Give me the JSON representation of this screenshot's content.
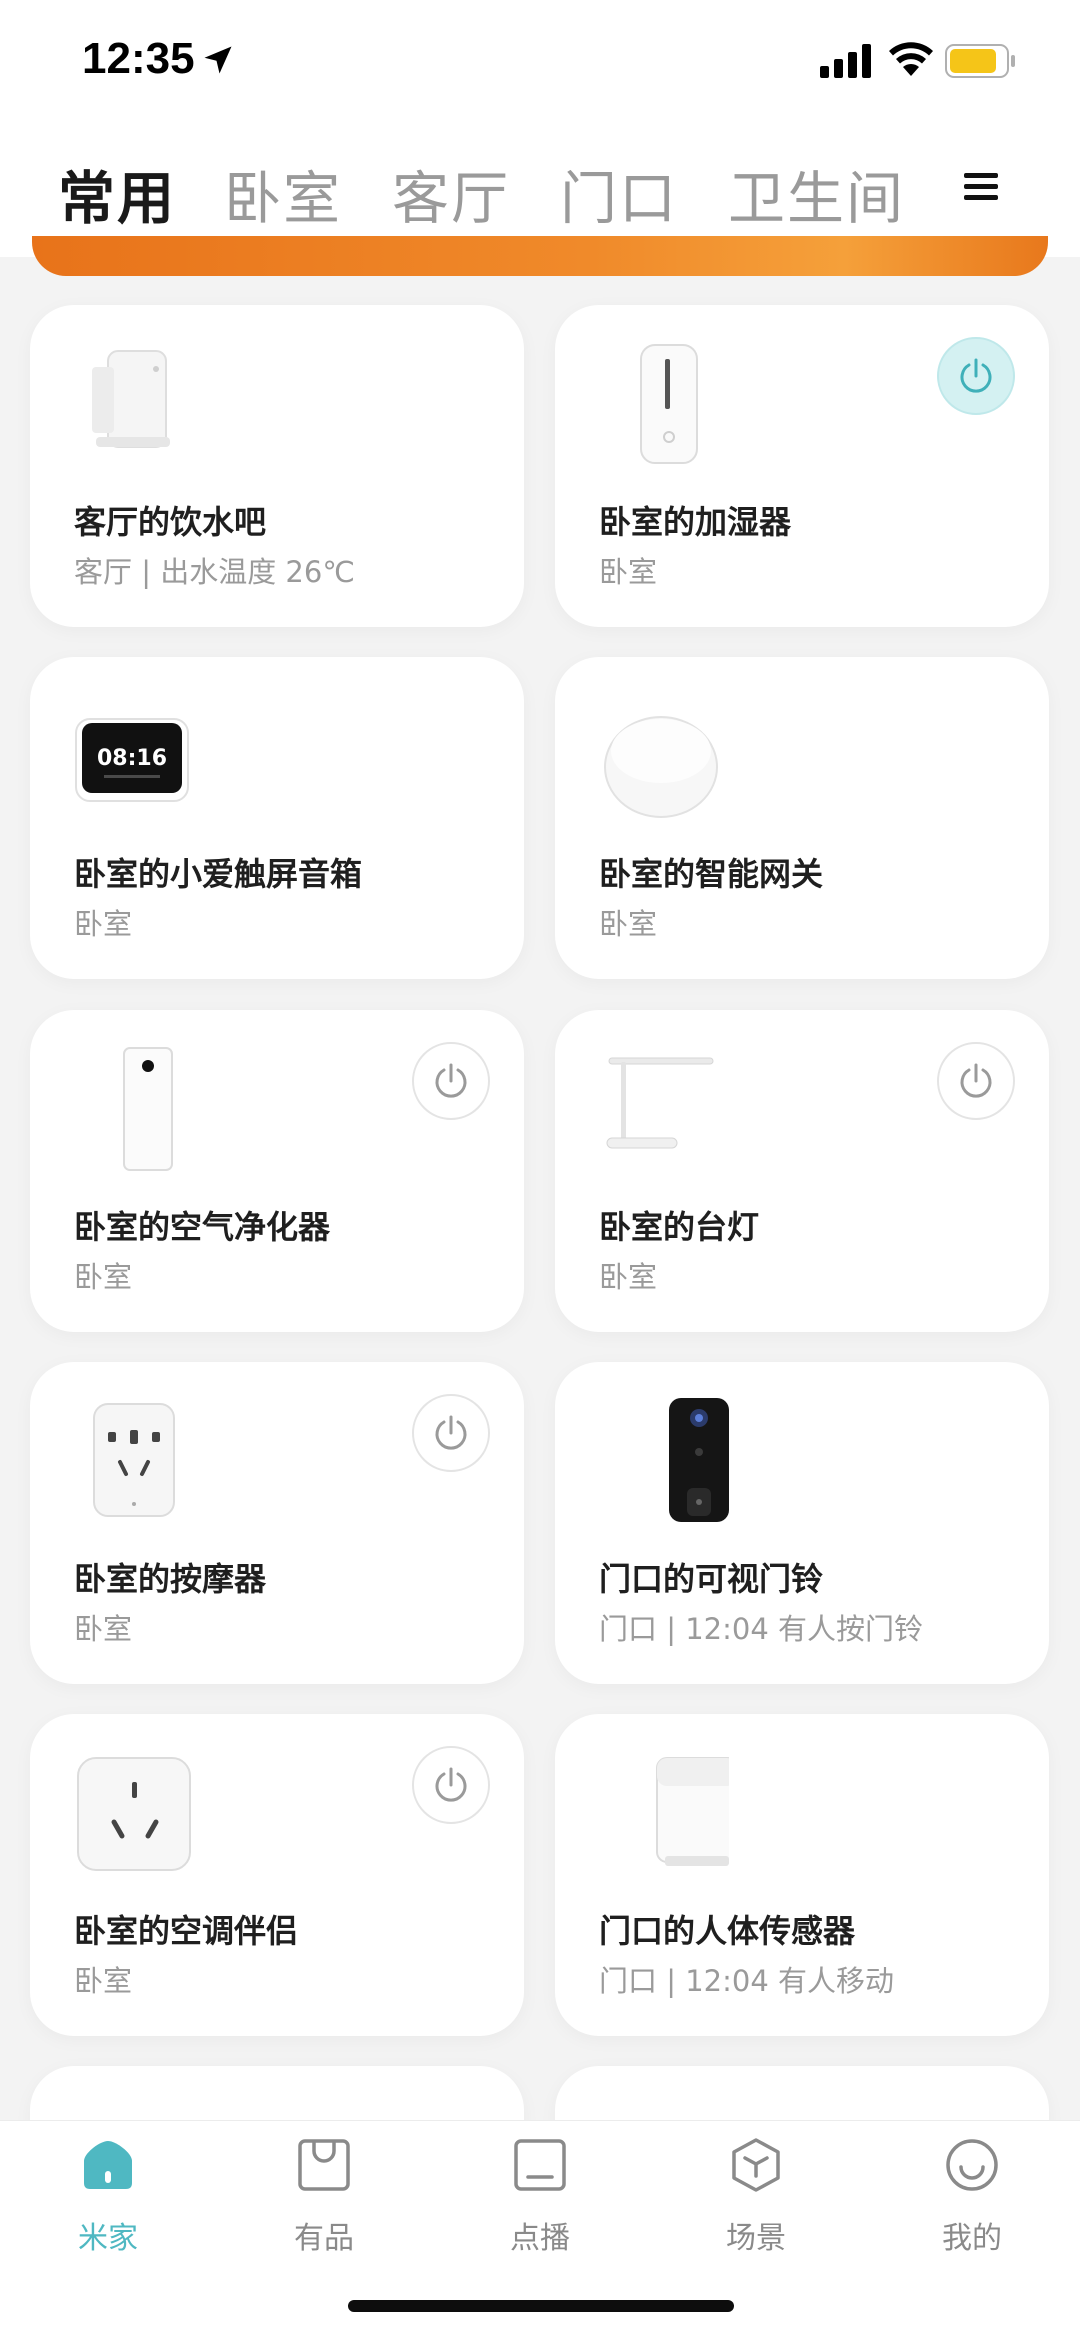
{
  "status": {
    "time": "12:35"
  },
  "tabs": [
    {
      "label": "常用",
      "active": true
    },
    {
      "label": "卧室",
      "active": false
    },
    {
      "label": "客厅",
      "active": false
    },
    {
      "label": "门口",
      "active": false
    },
    {
      "label": "卫生间",
      "active": false
    }
  ],
  "devices": [
    {
      "name": "客厅的饮水吧",
      "sub": "客厅 | 出水温度 26℃",
      "icon": "water-dispenser-icon",
      "power": "none"
    },
    {
      "name": "卧室的加湿器",
      "sub": "卧室",
      "icon": "humidifier-icon",
      "power": "on"
    },
    {
      "name": "卧室的小爱触屏音箱",
      "sub": "卧室",
      "icon": "smart-display-icon",
      "screen_time": "08:16",
      "power": "none"
    },
    {
      "name": "卧室的智能网关",
      "sub": "卧室",
      "icon": "gateway-icon",
      "power": "none"
    },
    {
      "name": "卧室的空气净化器",
      "sub": "卧室",
      "icon": "air-purifier-icon",
      "power": "off"
    },
    {
      "name": "卧室的台灯",
      "sub": "卧室",
      "icon": "desk-lamp-icon",
      "power": "off"
    },
    {
      "name": "卧室的按摩器",
      "sub": "卧室",
      "icon": "massager-plug-icon",
      "power": "off"
    },
    {
      "name": "门口的可视门铃",
      "sub": "门口 | 12:04 有人按门铃",
      "icon": "video-doorbell-icon",
      "power": "none"
    },
    {
      "name": "卧室的空调伴侣",
      "sub": "卧室",
      "icon": "ac-companion-icon",
      "power": "off"
    },
    {
      "name": "门口的人体传感器",
      "sub": "门口 | 12:04 有人移动",
      "icon": "motion-sensor-icon",
      "power": "none"
    }
  ],
  "nav": [
    {
      "label": "米家",
      "icon": "home-icon",
      "active": true
    },
    {
      "label": "有品",
      "icon": "shopping-bag-icon",
      "active": false
    },
    {
      "label": "点播",
      "icon": "tv-icon",
      "active": false
    },
    {
      "label": "场景",
      "icon": "cube-icon",
      "active": false
    },
    {
      "label": "我的",
      "icon": "smiley-icon",
      "active": false
    }
  ],
  "colors": {
    "accent": "#4fb8c2",
    "power_on_bg": "#d4f1f2",
    "banner": "#f08a2a",
    "inactive_text": "#9a9a9a"
  }
}
